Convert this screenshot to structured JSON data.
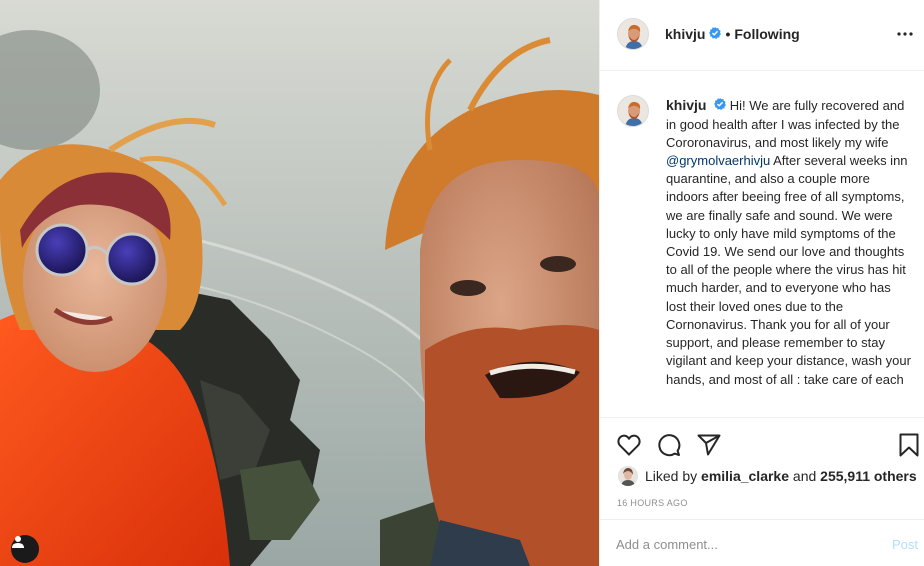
{
  "photo": {
    "user_tag_icon": "person-icon"
  },
  "header": {
    "username": "khivju",
    "verified_icon": "verified-badge-icon",
    "separator": "•",
    "follow_state": "Following",
    "more_icon": "more-options-icon"
  },
  "caption": {
    "username": "khivju",
    "text_before_mention": "Hi! We are fully recovered and in good health after I was infected by the Cororonavirus, and most likely my wife",
    "mention": "@grymolvaerhivju",
    "text_after_mention": "After several weeks inn quarantine, and also a couple more indoors after beeing free of all symptoms, we are finally safe and sound. We were lucky to only have mild symptoms of the Covid 19. We send our love and thoughts to all of the people where the virus has hit much harder, and to everyone who has lost their loved ones due to the Cornonavirus. Thank you for all of your support, and please remember to stay vigilant and keep your distance, wash your hands, and most of all : take care of each"
  },
  "actions": {
    "like_icon": "heart-icon",
    "comment_icon": "comment-icon",
    "share_icon": "share-icon",
    "save_icon": "bookmark-icon"
  },
  "likes": {
    "prefix": "Liked by",
    "liker": "emilia_clarke",
    "conjunction": "and",
    "count": "255,911 others"
  },
  "timestamp": "16 HOURS AGO",
  "comment_box": {
    "placeholder": "Add a comment...",
    "post_label": "Post"
  },
  "colors": {
    "verified_blue": "#3897f0",
    "post_disabled": "#b2dffc",
    "mention": "#00376b",
    "muted": "#8e8e8e"
  }
}
